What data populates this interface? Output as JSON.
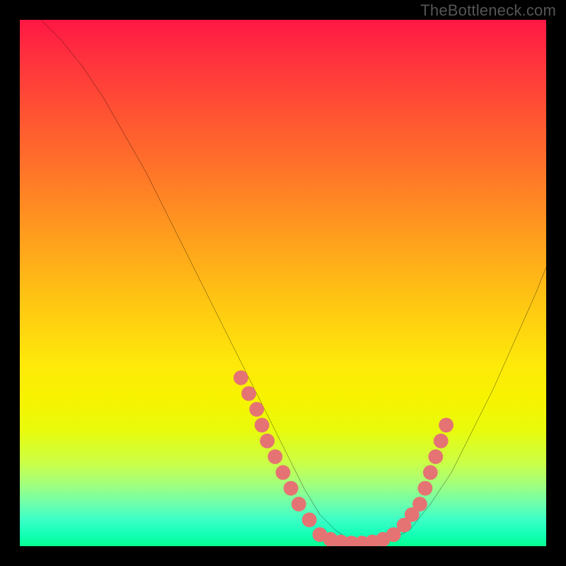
{
  "caption": "TheBottleneck.com",
  "chart_data": {
    "type": "line",
    "title": "",
    "xlabel": "",
    "ylabel": "",
    "xlim": [
      0,
      100
    ],
    "ylim": [
      0,
      100
    ],
    "series": [
      {
        "name": "main-curve",
        "color": "#000000",
        "x": [
          4,
          8,
          12,
          16,
          20,
          24,
          28,
          32,
          36,
          40,
          44,
          48,
          51,
          54,
          57,
          60,
          63,
          66,
          70,
          74,
          78,
          82,
          86,
          90,
          94,
          98,
          100
        ],
        "y": [
          100,
          96,
          91,
          85,
          78,
          71,
          63,
          55,
          47,
          39,
          31,
          23,
          17,
          11,
          6,
          3,
          1,
          0.5,
          1,
          3,
          8,
          14,
          22,
          30,
          39,
          48,
          53
        ]
      },
      {
        "name": "dots-left",
        "color": "#e57373",
        "type": "scatter",
        "x": [
          42,
          43.5,
          45,
          46,
          47,
          48.5,
          50,
          51.5,
          53,
          55
        ],
        "y": [
          32,
          29,
          26,
          23,
          20,
          17,
          14,
          11,
          8,
          5
        ]
      },
      {
        "name": "dots-bottom",
        "color": "#e57373",
        "type": "scatter",
        "x": [
          57,
          59,
          61,
          63,
          65,
          67,
          69,
          71
        ],
        "y": [
          2.2,
          1.3,
          0.8,
          0.6,
          0.6,
          0.8,
          1.3,
          2.2
        ]
      },
      {
        "name": "dots-right",
        "color": "#e57373",
        "type": "scatter",
        "x": [
          73,
          74.5,
          76,
          77,
          78,
          79,
          80,
          81
        ],
        "y": [
          4,
          6,
          8,
          11,
          14,
          17,
          20,
          23
        ]
      }
    ],
    "background_gradient": {
      "stops": [
        {
          "pos": 0,
          "color": "#ff1744"
        },
        {
          "pos": 6,
          "color": "#ff2d3f"
        },
        {
          "pos": 15,
          "color": "#ff4a35"
        },
        {
          "pos": 27,
          "color": "#ff6f2a"
        },
        {
          "pos": 40,
          "color": "#ff9a1e"
        },
        {
          "pos": 53,
          "color": "#ffc413"
        },
        {
          "pos": 65,
          "color": "#fee80a"
        },
        {
          "pos": 72,
          "color": "#f7f300"
        },
        {
          "pos": 78,
          "color": "#e8fb0c"
        },
        {
          "pos": 84,
          "color": "#ccff45"
        },
        {
          "pos": 88,
          "color": "#a5ff7a"
        },
        {
          "pos": 92,
          "color": "#6cffad"
        },
        {
          "pos": 95,
          "color": "#3bffc6"
        },
        {
          "pos": 97.5,
          "color": "#17ffb8"
        },
        {
          "pos": 99,
          "color": "#0bffa2"
        },
        {
          "pos": 100,
          "color": "#06ff8f"
        }
      ]
    }
  }
}
